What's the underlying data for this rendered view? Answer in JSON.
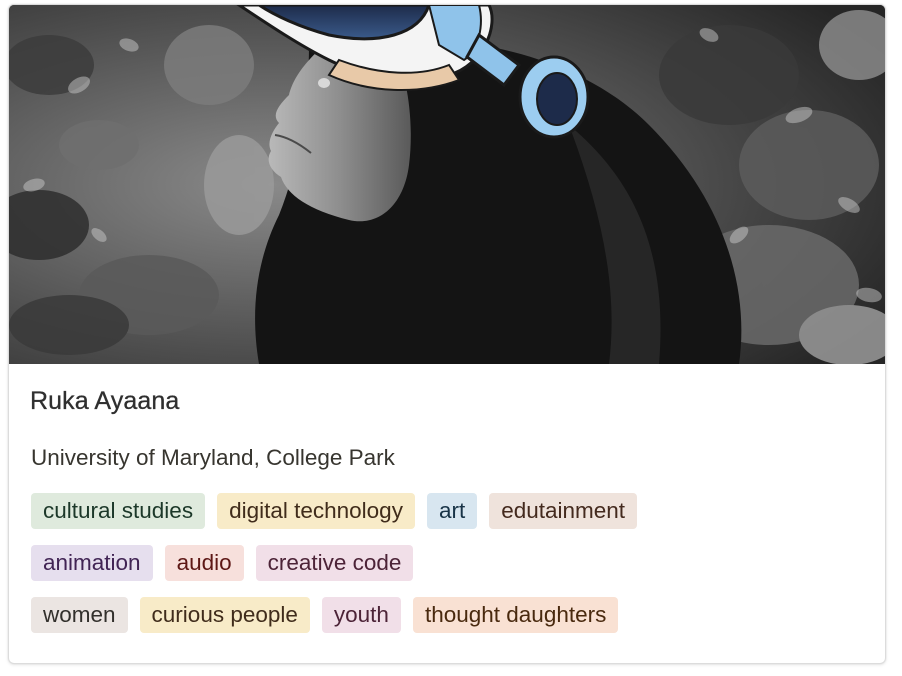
{
  "profile": {
    "name": "Ruka Ayaana",
    "affiliation": "University of Maryland, College Park",
    "cover_image": "black-and-white-portrait-with-cartoon-vr-headset"
  },
  "tags": [
    {
      "label": "cultural studies",
      "bg": "#dfeadd",
      "fg": "#1c3829"
    },
    {
      "label": "digital technology",
      "bg": "#f8ebc8",
      "fg": "#402c1b"
    },
    {
      "label": "art",
      "bg": "#d8e6f0",
      "fg": "#183347"
    },
    {
      "label": "edutainment",
      "bg": "#efe3dc",
      "fg": "#442a1e"
    },
    {
      "label": "animation",
      "bg": "#e6dfee",
      "fg": "#412454"
    },
    {
      "label": "audio",
      "bg": "#f7e0dc",
      "fg": "#5d1715"
    },
    {
      "label": "creative code",
      "bg": "#f1dfe8",
      "fg": "#4c2337"
    },
    {
      "label": "women",
      "bg": "#ebe5e2",
      "fg": "#32302c"
    },
    {
      "label": "curious people",
      "bg": "#f8ebc8",
      "fg": "#402c1b"
    },
    {
      "label": "youth",
      "bg": "#f1dfe8",
      "fg": "#4c2337"
    },
    {
      "label": "thought daughters",
      "bg": "#f9e1d3",
      "fg": "#49290e"
    }
  ]
}
